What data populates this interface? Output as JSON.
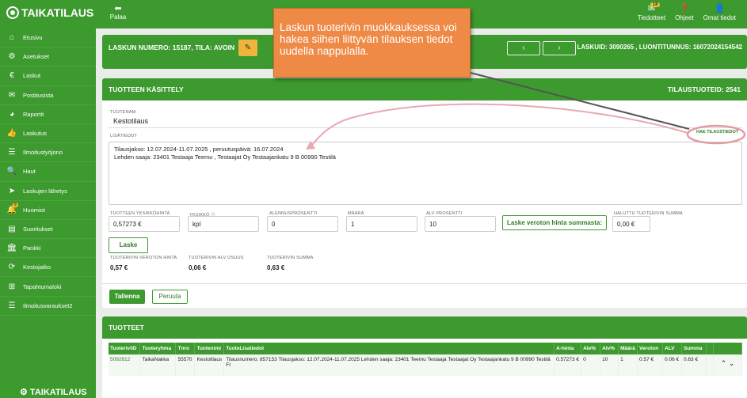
{
  "brand": "TAIKATILAUS",
  "topbar": {
    "back_label": "Palaa",
    "nav": [
      {
        "label": "Tiedotteet",
        "badge": "18",
        "icon": "envelope-icon"
      },
      {
        "label": "Ohjeet",
        "icon": "help-icon"
      },
      {
        "label": "Omat tiedot",
        "icon": "user-icon"
      }
    ]
  },
  "sidebar": {
    "items": [
      {
        "label": "Etusivu",
        "icon": "home-icon"
      },
      {
        "label": "Asetukset",
        "icon": "gear-icon"
      },
      {
        "label": "Laskut",
        "icon": "euro-icon"
      },
      {
        "label": "Postitusista",
        "icon": "mail-icon"
      },
      {
        "label": "Raportit",
        "icon": "pie-chart-icon"
      },
      {
        "label": "Laskutus",
        "icon": "thumbs-up-icon"
      },
      {
        "label": "Ilmoitustyöjono",
        "icon": "list-icon"
      },
      {
        "label": "Haut",
        "icon": "search-icon"
      },
      {
        "label": "Laskujen lähetys",
        "icon": "send-icon"
      },
      {
        "label": "Huomiot",
        "icon": "bell-icon",
        "badge": "9"
      },
      {
        "label": "Suoritukset",
        "icon": "inbox-icon"
      },
      {
        "label": "Pankki",
        "icon": "bank-icon"
      },
      {
        "label": "Kestojatko",
        "icon": "refresh-icon"
      },
      {
        "label": "Tapahtumaloki",
        "icon": "table-icon"
      },
      {
        "label": "Ilmoitusvaraukset2",
        "icon": "list-icon"
      }
    ],
    "footer_brand": "TAIKATILAUS"
  },
  "invoice": {
    "title": "LASKUN NUMERO: 15187, TILA: AVOIN",
    "right": "LASKUID: 3090265 , LUONTITUNNUS: 16072024154542"
  },
  "product_edit": {
    "header": "TUOTTEEN KÄSITTELY",
    "header_right": "TILAUSTUOTEID: 2541",
    "name_label": "TUOTENAM",
    "name_value": "Kestotilaus",
    "extra_label": "LISÄTIEDOT",
    "extra_line1": "Tilausjakso: 12.07.2024-11.07.2025 , peruutuspäivä: 16.07.2024",
    "extra_line2": "Lehden saaja: 23401 Testaaja Teemu , Testaajat Oy Testaajankatu 9 B 00990 Testilä",
    "fetch_orders": "HAE TILAUSTIEDOT",
    "unit_price_label": "TUOTTEEN YKSIKKÖHINTA",
    "unit_price_value": "0,57273 €",
    "unit_label": "YKSIKKÖ ⓘ",
    "unit_value": "kpl",
    "discount_label": "ALENNUSPROSENTTI",
    "discount_value": "0",
    "qty_label": "MÄÄRÄ",
    "qty_value": "1",
    "vat_label": "ALV PROSENTTI",
    "vat_value": "10",
    "calc_net_button": "Laske veroton hinta summasta:",
    "wanted_sum_label": "HALUTTU TUOTERIVIN SUMMA",
    "wanted_sum_value": "0,00 €",
    "calc_button": "Laske",
    "net_label": "TUOTERIVIN VEROTON HINTA",
    "net_value": "0,57 €",
    "vat_share_label": "TUOTERIVIN ALV OSUUS",
    "vat_share_value": "0,06 €",
    "sum_label": "TUOTERIVIN SUMMA",
    "sum_value": "0,63 €",
    "save_button": "Tallenna",
    "cancel_button": "Peruuta"
  },
  "products": {
    "header": "TUOTTEET",
    "columns": [
      "TuoterivilD",
      "Tuoteryhma",
      "Tnro",
      "Tuotenimi",
      "TuoteLisatiedot",
      "A-hinta",
      "Ale%",
      "Alv%",
      "Määrä",
      "Veroton",
      "ALV",
      "Summa"
    ],
    "rows": [
      [
        "5092812",
        "TaikaNakka",
        "55570",
        "Kestotilaus",
        "Tilausnumero: 857153 Tilausjakso: 12.07.2024-11.07.2025 Lehden saaja: 23401 Teemu Testaaja Testaajat Oy Testaajankatu 9 B 00990 Testilä FI",
        "0.57273 €",
        "0",
        "10",
        "1",
        "0.57 €",
        "0.06 €",
        "0.63 €"
      ]
    ]
  },
  "callout": "Laskun tuoterivin muokkauksessa voi hakea siihen liittyvän tilauksen tiedot uudella nappulalla."
}
